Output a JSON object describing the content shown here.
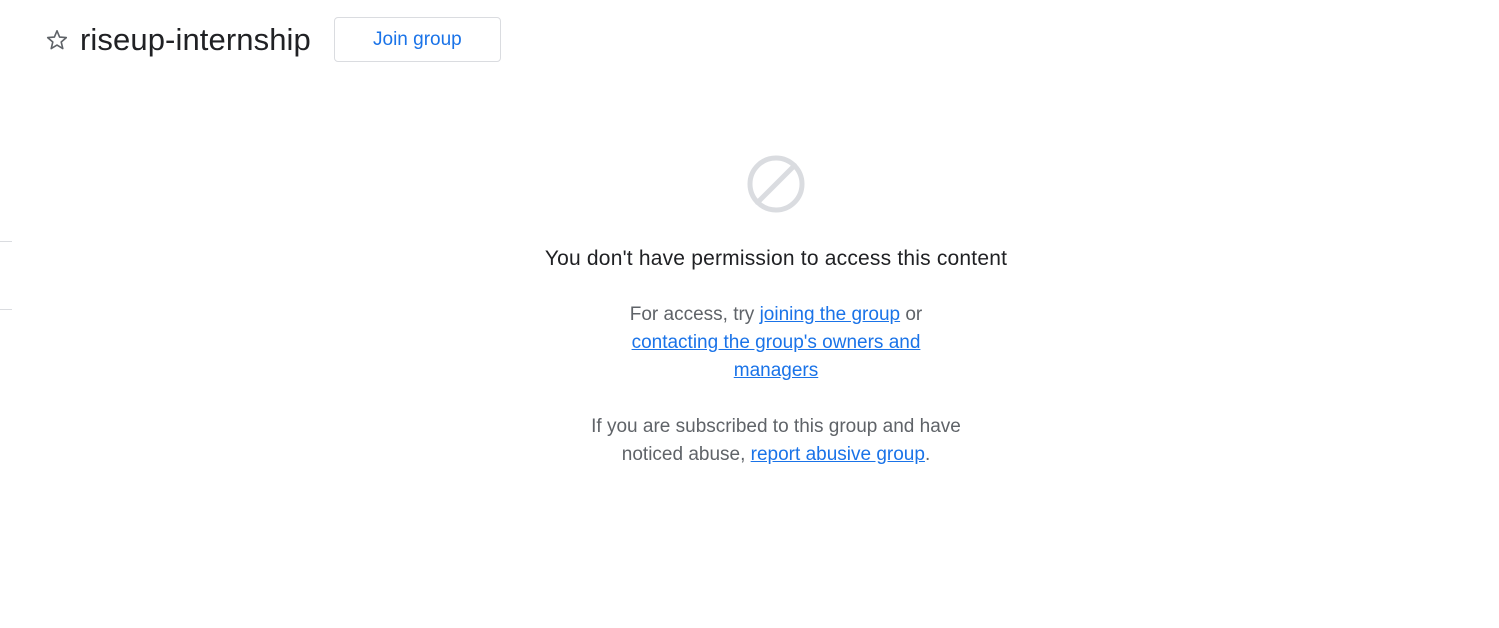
{
  "header": {
    "group_name": "riseup-internship",
    "join_button_label": "Join group",
    "star_icon": "star-outline-icon"
  },
  "message": {
    "icon": "blocked-icon",
    "heading": "You don't have permission to access this content",
    "access": {
      "prefix": "For access, try ",
      "join_link": "joining the group",
      "middle": " or ",
      "contact_link": "contacting the group's owners and managers"
    },
    "abuse": {
      "prefix": "If you are subscribed to this group and have noticed abuse, ",
      "report_link": "report abusive group",
      "suffix": "."
    }
  },
  "colors": {
    "accent": "#1a73e8",
    "text": "#202124",
    "secondary_text": "#5f6368",
    "icon_gray": "#dadce0"
  }
}
